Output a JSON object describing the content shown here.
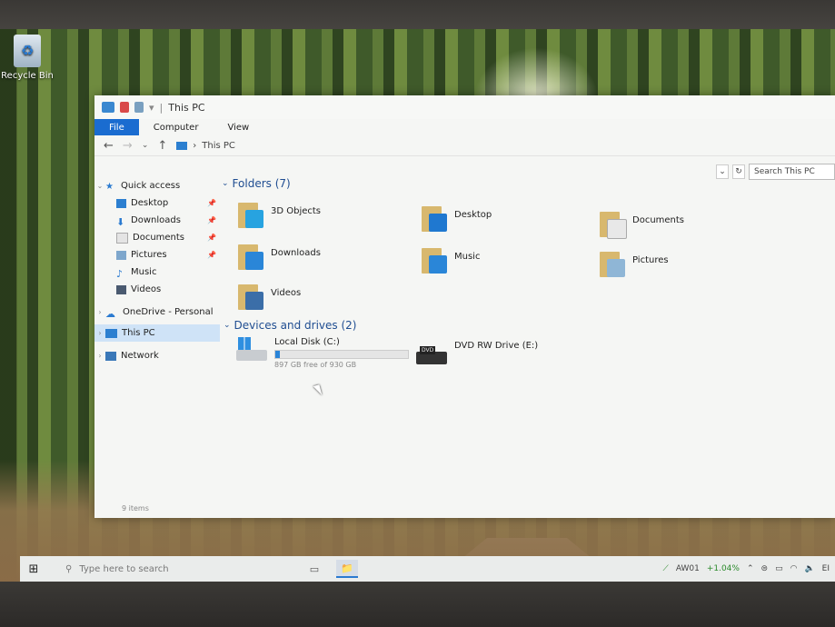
{
  "desktop": {
    "recycle_bin_label": "Recycle Bin"
  },
  "window": {
    "title": "This PC",
    "ribbon_tabs": [
      "File",
      "Computer",
      "View"
    ],
    "address_path": "This PC",
    "search_placeholder": "Search This PC",
    "status_text": "9 items"
  },
  "nav_pane": {
    "quick_access_label": "Quick access",
    "quick_items": [
      {
        "label": "Desktop",
        "icon": "desktop-icon",
        "pinned": true
      },
      {
        "label": "Downloads",
        "icon": "download-icon",
        "pinned": true
      },
      {
        "label": "Documents",
        "icon": "documents-icon",
        "pinned": true
      },
      {
        "label": "Pictures",
        "icon": "pictures-icon",
        "pinned": true
      },
      {
        "label": "Music",
        "icon": "music-icon",
        "pinned": false
      },
      {
        "label": "Videos",
        "icon": "videos-icon",
        "pinned": false
      }
    ],
    "onedrive_label": "OneDrive - Personal",
    "this_pc_label": "This PC",
    "network_label": "Network"
  },
  "content": {
    "folders_header": "Folders (7)",
    "folders": [
      {
        "label": "3D Objects",
        "icon": "3d-objects-icon",
        "color": "#27a3e0"
      },
      {
        "label": "Desktop",
        "icon": "desktop-folder-icon",
        "color": "#1f78d0"
      },
      {
        "label": "Documents",
        "icon": "documents-folder-icon",
        "color": "#e8e8e8"
      },
      {
        "label": "Downloads",
        "icon": "downloads-folder-icon",
        "color": "#2a86d8"
      },
      {
        "label": "Music",
        "icon": "music-folder-icon",
        "color": "#2a86d8"
      },
      {
        "label": "Pictures",
        "icon": "pictures-folder-icon",
        "color": "#8fb6d6"
      },
      {
        "label": "Videos",
        "icon": "videos-folder-icon",
        "color": "#3b6ea8"
      }
    ],
    "devices_header": "Devices and drives (2)",
    "drives": [
      {
        "label": "Local Disk (C:)",
        "free_text": "897 GB free of 930 GB",
        "used_fraction": 0.035
      },
      {
        "label": "DVD RW Drive (E:)",
        "tag": "DVD"
      }
    ]
  },
  "taskbar": {
    "search_placeholder": "Type here to search",
    "tray_label": "AW01",
    "tray_value": "+1.04%",
    "tray_ending": "EI"
  },
  "colors": {
    "accent": "#1a6cd0",
    "header_text": "#1f4d91"
  }
}
